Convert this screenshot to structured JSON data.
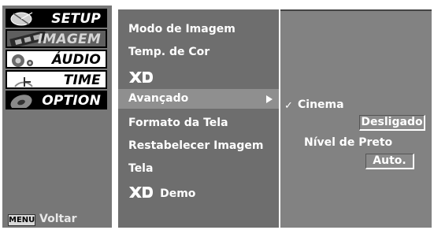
{
  "colors": {
    "left_panel_bg": "#777777",
    "submenu_bg": "#6e6e6e",
    "highlight_bg": "#8f8f8f",
    "options_bg": "#828282",
    "text": "#ffffff"
  },
  "left_menu": {
    "tabs": [
      {
        "label": "SETUP",
        "icon": "satellite-dish-icon",
        "style": "black"
      },
      {
        "label": "IMAGEM",
        "icon": "film-strip-icon",
        "style": "active"
      },
      {
        "label": "ÁUDIO",
        "icon": "speaker-icon",
        "style": "white"
      },
      {
        "label": "TIME",
        "icon": "clock-icon",
        "style": "white"
      },
      {
        "label": "OPTION",
        "icon": "option-disc-icon",
        "style": "black"
      }
    ],
    "back": {
      "key": "MENU",
      "label": "Voltar"
    }
  },
  "submenu": {
    "items": [
      {
        "label": "Modo de Imagem"
      },
      {
        "label": "Temp. de Cor"
      },
      {
        "label": "XD",
        "icon": "xd-logo-icon"
      },
      {
        "label": "Avançado",
        "selected": true,
        "has_arrow": true
      },
      {
        "label": "Formato da Tela"
      },
      {
        "label": "Restabelecer Imagem"
      },
      {
        "label": "Tela"
      },
      {
        "label": "Demo",
        "icon": "xd-logo-icon"
      }
    ]
  },
  "options_panel": {
    "cinema": {
      "label": "Cinema",
      "checked": true,
      "value": "Desligado"
    },
    "black_level": {
      "label": "Nível de Preto",
      "value": "Auto."
    }
  }
}
